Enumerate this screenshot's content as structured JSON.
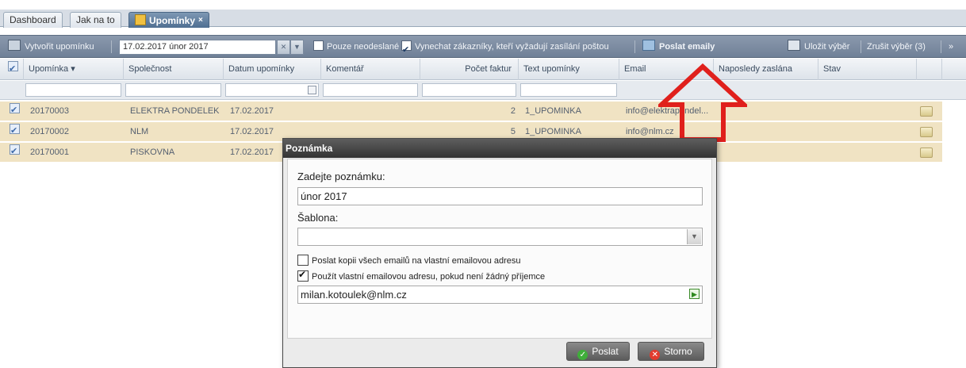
{
  "tabs": [
    {
      "label": "Dashboard"
    },
    {
      "label": "Jak na to"
    },
    {
      "label": "Upomínky",
      "close": "×"
    }
  ],
  "toolbar": {
    "create_label": "Vytvořit upomínku",
    "date_value": "17.02.2017 únor 2017",
    "only_unsent_label": "Pouze neodeslané",
    "skip_customers_label": "Vynechat zákazníky, kteří vyžadují zasílání poštou",
    "send_emails_label": "Poslat emaily",
    "save_selection_label": "Uložit výběr",
    "cancel_selection_label": "Zrušit výběr (3)",
    "more": "»"
  },
  "grid": {
    "columns": [
      "Upomínka",
      "Společnost",
      "Datum upomínky",
      "Komentář",
      "Počet faktur",
      "Text upomínky",
      "Email",
      "Naposledy zaslána",
      "Stav"
    ],
    "sort_indicator": "▾",
    "rows": [
      {
        "upominka": "20170003",
        "spolecnost": "ELEKTRA PONDELEK",
        "datum": "17.02.2017",
        "pocet": "2",
        "text": "1_UPOMINKA",
        "email": "info@elektrapondel..."
      },
      {
        "upominka": "20170002",
        "spolecnost": "NLM",
        "datum": "17.02.2017",
        "pocet": "5",
        "text": "1_UPOMINKA",
        "email": "info@nlm.cz"
      },
      {
        "upominka": "20170001",
        "spolecnost": "PISKOVNA",
        "datum": "17.02.2017",
        "pocet": "",
        "text": "",
        "email": ""
      }
    ]
  },
  "dialog": {
    "title": "Poznámka",
    "note_label": "Zadejte poznámku:",
    "note_value": "únor 2017",
    "template_label": "Šablona:",
    "template_value": "",
    "copy_label": "Poslat kopii všech emailů na vlastní emailovou adresu",
    "own_address_label": "Použít vlastní emailovou adresu, pokud není žádný příjemce",
    "own_email_value": "milan.kotoulek@nlm.cz",
    "send_button": "Poslat",
    "cancel_button": "Storno"
  },
  "colors": {
    "row_highlight": "#f0e3c3",
    "annotation_arrow": "#e0201c",
    "toolbar": "#7a8aa0"
  }
}
